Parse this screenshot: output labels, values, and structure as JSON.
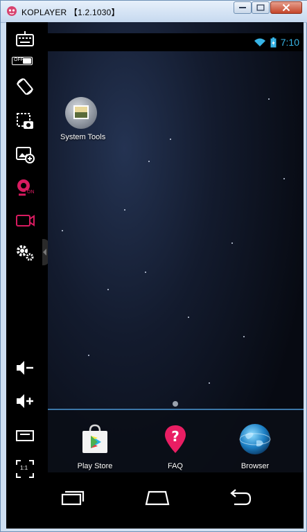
{
  "window": {
    "title": "KOPLAYER 【1.2.1030】"
  },
  "sidebar": {
    "toggle_label": "OFF",
    "camera_on_label": "ON",
    "scale_label": "1:1"
  },
  "statusbar": {
    "time": "7:10"
  },
  "desktop": {
    "apps": [
      {
        "label": "System Tools",
        "icon": "system-tools-icon"
      }
    ]
  },
  "dock": {
    "apps": [
      {
        "label": "Play Store",
        "icon": "play-store-icon"
      },
      {
        "label": "FAQ",
        "icon": "faq-icon"
      },
      {
        "label": "Browser",
        "icon": "browser-icon"
      }
    ]
  },
  "colors": {
    "accent_pink": "#d81b60",
    "status_blue": "#37b4e6",
    "dock_line": "#3c77a8"
  }
}
